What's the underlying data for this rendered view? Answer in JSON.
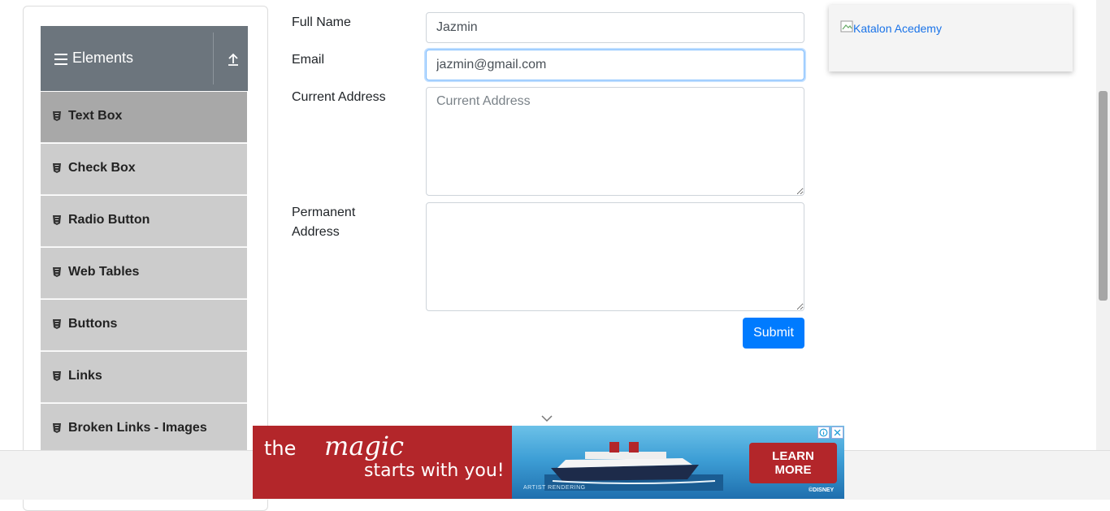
{
  "sidebar": {
    "group_title": "Elements",
    "items": [
      {
        "label": "Text Box",
        "active": true
      },
      {
        "label": "Check Box",
        "active": false
      },
      {
        "label": "Radio Button",
        "active": false
      },
      {
        "label": "Web Tables",
        "active": false
      },
      {
        "label": "Buttons",
        "active": false
      },
      {
        "label": "Links",
        "active": false
      },
      {
        "label": "Broken Links - Images",
        "active": false
      }
    ]
  },
  "form": {
    "full_name": {
      "label": "Full Name",
      "value": "Jazmin"
    },
    "email": {
      "label": "Email",
      "value": "jazmin@gmail.com"
    },
    "current_address": {
      "label": "Current Address",
      "placeholder": "Current Address",
      "value": ""
    },
    "permanent_address": {
      "label_line1": "Permanent",
      "label_line2": "Address",
      "value": ""
    },
    "submit_label": "Submit"
  },
  "side_ad": {
    "alt_text": "Katalon Acedemy"
  },
  "banner_ad": {
    "tagline_a": "the",
    "tagline_b": "magic",
    "tagline_c": "starts with you!",
    "cta_line1": "LEARN",
    "cta_line2": "MORE",
    "fine_print": "ARTIST RENDERING",
    "brand": "©DISNEY",
    "accent_color": "#b3262a"
  },
  "colors": {
    "primary_button": "#007bff",
    "sidebar_header": "#6c757d",
    "sidebar_item": "#cccccc",
    "sidebar_item_active": "#a8a8a8"
  }
}
